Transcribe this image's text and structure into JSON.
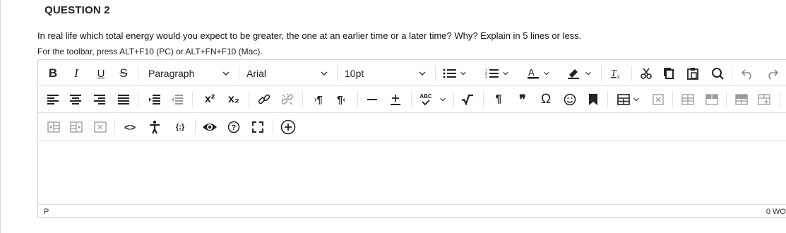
{
  "question": {
    "title": "QUESTION 2",
    "text": "In real life which total energy would you expect to be greater, the one at an earlier time or a later time?  Why?  Explain in 5 lines or less.",
    "toolbar_hint": "For the toolbar, press ALT+F10 (PC) or ALT+FN+F10 (Mac)."
  },
  "editor": {
    "format_block": "Paragraph",
    "font_family": "Arial",
    "font_size": "10pt",
    "bold_label": "B",
    "italic_label": "I",
    "underline_label": "U",
    "strike_label": "S",
    "superscript_label": "x²",
    "subscript_label": "x₂",
    "ltr_label": "¶",
    "rtl_label": "¶",
    "spellcheck_label": "ABC",
    "paragraph_label": "¶",
    "quote_label": "❞",
    "omega_label": "Ω",
    "code_label": "<>",
    "mathml_label": "{;}",
    "status_path": "P",
    "word_count": "0 WO"
  },
  "colors": {
    "border": "#cfcfcf",
    "icon": "#222222"
  }
}
